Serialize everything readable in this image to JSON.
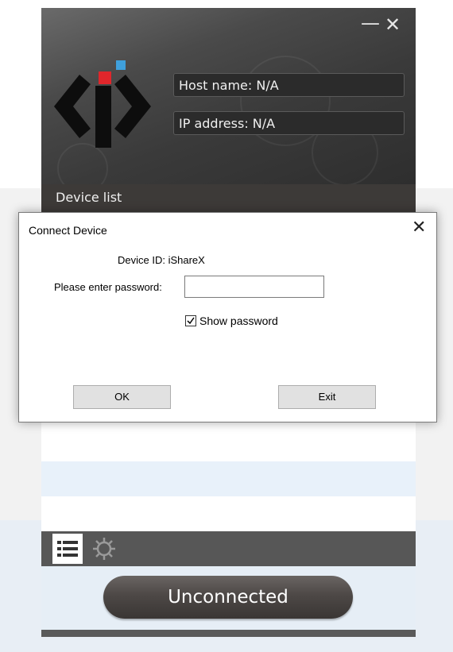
{
  "window": {
    "minimize_glyph": "—",
    "close_glyph": "✕"
  },
  "header": {
    "host_name": "Host name: N/A",
    "ip_address": "IP address: N/A",
    "device_list_label": "Device list"
  },
  "dialog": {
    "title": "Connect Device",
    "close_glyph": "✕",
    "device_id": "Device ID: iShareX",
    "password_label": "Please enter password:",
    "password_value": "",
    "show_password_label": "Show password",
    "show_password_checked": true,
    "ok_label": "OK",
    "exit_label": "Exit"
  },
  "toolbar": {
    "list_icon": "list-icon",
    "settings_icon": "gear-icon"
  },
  "status": {
    "connect_button_label": "Unconnected"
  },
  "colors": {
    "logo_red": "#e0262b",
    "logo_blue": "#3fa0dc",
    "selected_row": "#e8f1fa"
  }
}
